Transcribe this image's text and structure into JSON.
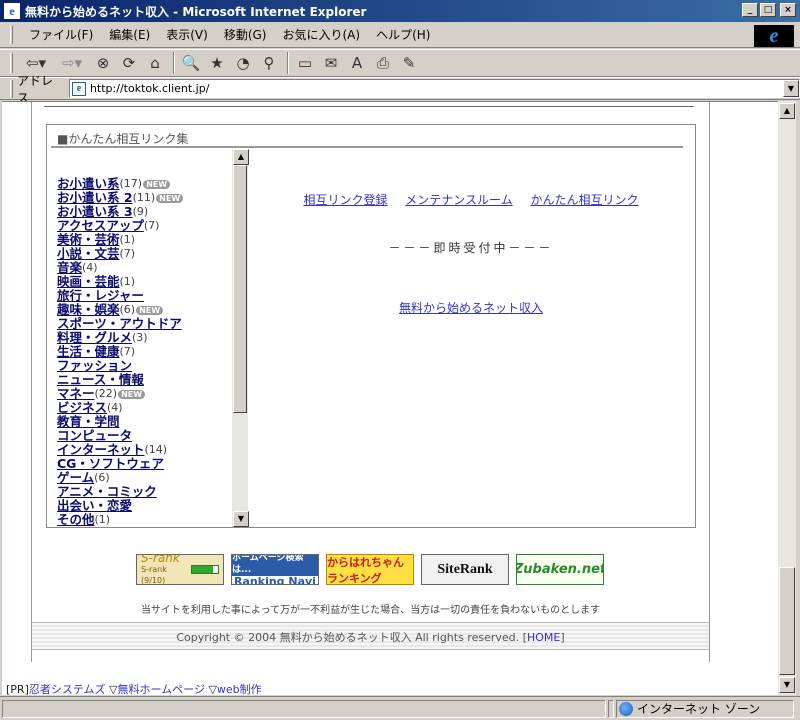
{
  "window": {
    "title": "無料から始めるネット収入 - Microsoft Internet Explorer",
    "app_icon": "e",
    "buttons": {
      "minimize": "_",
      "maximize": "□",
      "close": "×"
    }
  },
  "menubar": {
    "items": [
      "ファイル(F)",
      "編集(E)",
      "表示(V)",
      "移動(G)",
      "お気に入り(A)",
      "ヘルプ(H)"
    ],
    "logo": "e"
  },
  "toolbar": {
    "back_glyph": "⇦▾",
    "forward_glyph": "⇨▾",
    "stop_glyph": "⊗",
    "refresh_glyph": "⟳",
    "home_glyph": "⌂",
    "search_glyph": "🔍",
    "favorites_glyph": "★",
    "history_glyph": "◔",
    "channels_glyph": "⚲",
    "fullscreen_glyph": "▭",
    "mail_glyph": "✉",
    "fontsize_glyph": "A",
    "print_glyph": "⎙",
    "edit_glyph": "✎"
  },
  "address": {
    "label": "アドレス",
    "url": "http://toktok.client.jp/",
    "page_icon": "e",
    "dropdown": "▼"
  },
  "section": {
    "heading": "■かんたん相互リンク集"
  },
  "categories": [
    {
      "name": "お小遣い系",
      "count": "(17)",
      "new": "NEW"
    },
    {
      "name": "お小遣い系 2",
      "count": "(11)",
      "new": "NEW"
    },
    {
      "name": "お小遣い系 3",
      "count": "(9)",
      "new": ""
    },
    {
      "name": "アクセスアップ",
      "count": "(7)",
      "new": ""
    },
    {
      "name": "美術・芸術",
      "count": "(1)",
      "new": ""
    },
    {
      "name": "小説・文芸",
      "count": "(7)",
      "new": ""
    },
    {
      "name": "音楽",
      "count": "(4)",
      "new": ""
    },
    {
      "name": "映画・芸能",
      "count": "(1)",
      "new": ""
    },
    {
      "name": "旅行・レジャー",
      "count": "",
      "new": ""
    },
    {
      "name": "趣味・娯楽",
      "count": "(6)",
      "new": "NEW"
    },
    {
      "name": "スポーツ・アウトドア",
      "count": "",
      "new": ""
    },
    {
      "name": "料理・グルメ",
      "count": "(3)",
      "new": ""
    },
    {
      "name": "生活・健康",
      "count": "(7)",
      "new": ""
    },
    {
      "name": "ファッション",
      "count": "",
      "new": ""
    },
    {
      "name": "ニュース・情報",
      "count": "",
      "new": ""
    },
    {
      "name": "マネー",
      "count": "(22)",
      "new": "NEW"
    },
    {
      "name": "ビジネス",
      "count": "(4)",
      "new": ""
    },
    {
      "name": "教育・学問",
      "count": "",
      "new": ""
    },
    {
      "name": "コンピュータ",
      "count": "",
      "new": ""
    },
    {
      "name": "インターネット",
      "count": "(14)",
      "new": ""
    },
    {
      "name": "CG・ソフトウェア",
      "count": "",
      "new": ""
    },
    {
      "name": "ゲーム",
      "count": "(6)",
      "new": ""
    },
    {
      "name": "アニメ・コミック",
      "count": "",
      "new": ""
    },
    {
      "name": "出会い・恋愛",
      "count": "",
      "new": ""
    },
    {
      "name": "その他",
      "count": "(1)",
      "new": ""
    }
  ],
  "links": {
    "register": "相互リンク登録",
    "maintenance": "メンテナンスルーム",
    "easy": "かんたん相互リンク",
    "status": "－－－即時受付中－－－",
    "site": "無料から始めるネット収入"
  },
  "banners": {
    "srank_title": "S-rank",
    "srank_score": "S-rank (9/10)",
    "rnavi_top": "ホームページ検索は...",
    "rnavi_bottom": "Ranking Navi",
    "karaha": "からはれちゃん ランキング",
    "siterank": "SiteRank",
    "zubaken": "Zubaken.net"
  },
  "disclaimer": "当サイトを利用した事によって万が一不利益が生じた場合、当方は一切の責任を負わないものとします",
  "footer": {
    "copyright": "Copyright © 2004 無料から始めるネット収入 All rights reserved. [",
    "home": "HOME",
    "close_bracket": "]"
  },
  "pr": {
    "label": "[PR]",
    "link1": "忍者システムズ",
    "sep1": " ▽",
    "link2": "無料ホームページ",
    "sep2": " ▽",
    "link3": "web制作"
  },
  "status": {
    "zone": "インターネット ゾーン"
  }
}
